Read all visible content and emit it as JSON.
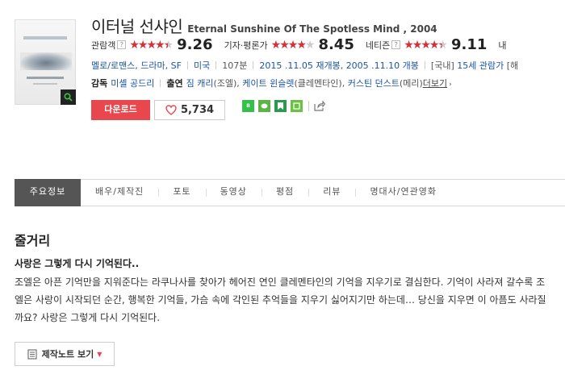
{
  "movie": {
    "title_ko": "이터널 선샤인",
    "title_en": "Eternal Sunshine Of The Spotless Mind , 2004"
  },
  "ratings": [
    {
      "label": "관람객",
      "stars": 4.5,
      "score": "9.26",
      "help": "?"
    },
    {
      "label": "기자·평론가",
      "stars": 4.0,
      "score": "8.45",
      "help": ""
    },
    {
      "label": "네티즌",
      "stars": 4.5,
      "score": "9.11",
      "help": "?"
    },
    {
      "label": "내",
      "stars": 0,
      "score": "",
      "help": ""
    }
  ],
  "meta": {
    "genre": "멜로/로맨스, 드라마, SF",
    "country": "미국",
    "runtime": "107분",
    "release_re": "2015 .11.05 재개봉",
    "release": "2005 .11.10 개봉",
    "rating_prefix": "[국내]",
    "rating": "15세 관람가",
    "rating_tail": "[해"
  },
  "credits": {
    "director_label": "감독",
    "director": "미셸 공드리",
    "cast_label": "출연",
    "cast": [
      {
        "name": "짐 캐리",
        "role": "(조엘)"
      },
      {
        "name": "케이트 윈슬렛",
        "role": "(클레멘타인)"
      },
      {
        "name": "커스틴 던스트",
        "role": "(메리)"
      }
    ],
    "more": "더보기"
  },
  "actions": {
    "download": "다운로드",
    "likes": "5,734"
  },
  "share_icons": [
    "band-icon",
    "kakao-icon",
    "bookmark-icon",
    "line-icon"
  ],
  "tabs": [
    "주요정보",
    "배우/제작진",
    "포토",
    "동영상",
    "평점",
    "리뷰",
    "명대사/연관영화"
  ],
  "synopsis": {
    "heading": "줄거리",
    "tagline": "사랑은 그렇게 다시 기억된다..",
    "body": "조엘은 아픈 기억만을 지워준다는 라쿠나사를 찾아가 헤어진 연인 클레멘타인의 기억을 지우기로 결심한다. 기억이 사라져 갈수록 조엘은 사랑이 시작되던 순간, 행복한 기억들, 가슴 속에 각인된 추억들을 지우기 싫어지기만 하는데… 당신을 지우면 이 아픔도 사라질까요? 사랑은 그렇게 다시 기억된다.",
    "notes_button": "제작노트 보기"
  },
  "colors": {
    "accent": "#e9474e",
    "link": "#1a55a5",
    "active_tab": "#555555"
  }
}
